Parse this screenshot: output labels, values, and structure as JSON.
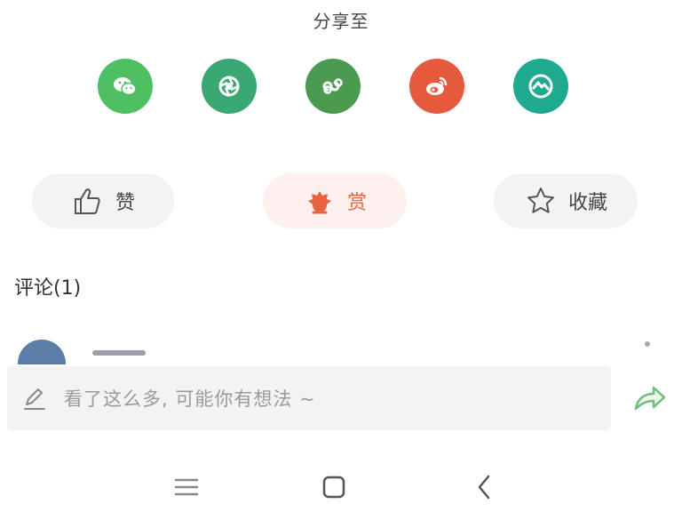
{
  "share": {
    "title": "分享至",
    "targets": [
      {
        "name": "wechat",
        "icon": "wechat-icon",
        "color": "#4fbf63"
      },
      {
        "name": "moments",
        "icon": "moments-icon",
        "color": "#3aa872"
      },
      {
        "name": "mini-program",
        "icon": "mini-program-icon",
        "color": "#4a9b4f"
      },
      {
        "name": "weibo",
        "icon": "weibo-icon",
        "color": "#e55a3c"
      },
      {
        "name": "qzone",
        "icon": "qzone-icon",
        "color": "#1fa98f"
      }
    ]
  },
  "actions": {
    "like_label": "赞",
    "reward_label": "赏",
    "favorite_label": "收藏",
    "reward_color": "#e8633e"
  },
  "comments": {
    "title": "评论(1)"
  },
  "input": {
    "placeholder": "看了这么多, 可能你有想法 ~"
  },
  "navbar": {
    "keys": [
      "menu-icon",
      "home-icon",
      "back-icon"
    ]
  }
}
